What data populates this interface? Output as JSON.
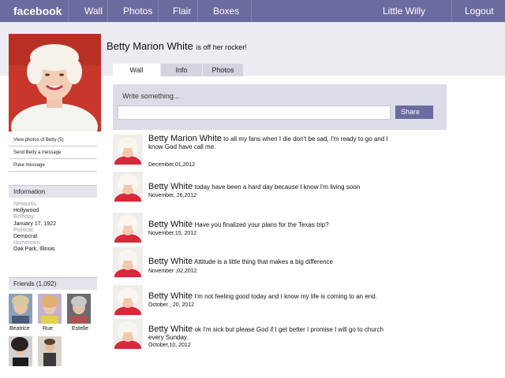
{
  "topbar": {
    "logo": "facebook",
    "nav": [
      "Wall",
      "Photos",
      "Flair",
      "Boxes"
    ],
    "user": "Little Willy",
    "logout": "Logout"
  },
  "profile": {
    "links": [
      "View photos of Betty (5)",
      "Send Betty a message",
      "Poke message"
    ],
    "info_title": "Information",
    "info": [
      {
        "label": "Networks",
        "value": "Hollywood"
      },
      {
        "label": "Birthday:",
        "value": "January 17, 1922"
      },
      {
        "label": "Political:",
        "value": "Democrat"
      },
      {
        "label": "Hometown:",
        "value": "Oak Park, Illinois"
      }
    ],
    "friends_title": "Friends (1,092)",
    "friends": [
      "Beatrice",
      "Rue",
      "Estelle"
    ]
  },
  "header": {
    "name": "Betty Marion White",
    "status": "is off her rocker!"
  },
  "tabs": [
    "Wall",
    "Info",
    "Photos"
  ],
  "composer": {
    "prompt": "Write something...",
    "share": "Share"
  },
  "posts": [
    {
      "name": "Betty Marion White",
      "text": "to all my fans when I die don't be sad, I'm ready to go and I know God have call me.",
      "date": "December,01,2012"
    },
    {
      "name": "Betty White",
      "text": "today have been a hard day because I know I'm living soon",
      "date": "November, 26,2012"
    },
    {
      "name": "Betty White",
      "text": "Have you finalized your plans for the Texas trip?",
      "date": "November,15, 2012"
    },
    {
      "name": "Betty White",
      "text": "Attitude is a little thing that makes a big difference",
      "date": "November ,02,2012"
    },
    {
      "name": "Betty White",
      "text": "I'm not feeling good today and I know my life is coming to an end.",
      "date": "October , 20, 2012"
    },
    {
      "name": "Betty White",
      "text": "ok I'm sick but please God if I get better I promise I will go to church every Sunday.",
      "date": "October,10, 2012"
    }
  ]
}
